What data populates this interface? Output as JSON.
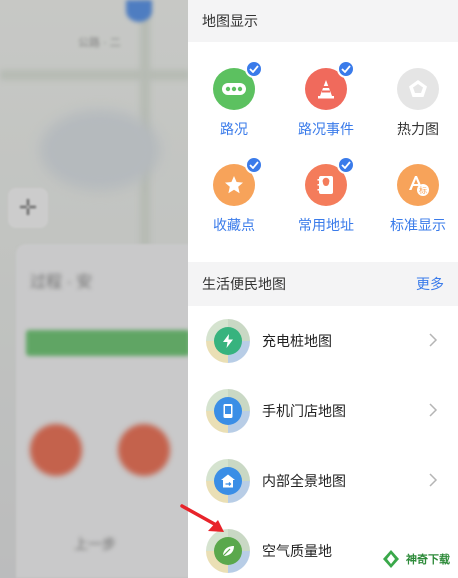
{
  "background": {
    "map_label": "公路 · 二",
    "panel_title": "过程 · 安",
    "bottom_text": "上一步"
  },
  "map_display": {
    "header": "地图显示",
    "tiles": [
      {
        "label": "路况",
        "icon": "traffic-icon",
        "checked": true,
        "color": "#5cc160",
        "label_color": "#3a7bea"
      },
      {
        "label": "路况事件",
        "icon": "traffic-cone-icon",
        "checked": true,
        "color": "#f06a5c",
        "label_color": "#3a7bea"
      },
      {
        "label": "热力图",
        "icon": "heatmap-pentagon-icon",
        "checked": false,
        "color": "#e5e5e5",
        "label_color": "#333333"
      },
      {
        "label": "收藏点",
        "icon": "star-icon",
        "checked": true,
        "color": "#f7a35a",
        "label_color": "#3a7bea"
      },
      {
        "label": "常用地址",
        "icon": "address-book-icon",
        "checked": true,
        "color": "#f47c5b",
        "label_color": "#3a7bea"
      },
      {
        "label": "标准显示",
        "icon": "standard-display-icon",
        "checked": false,
        "color": "#f7a35a",
        "label_color": "#3a7bea"
      }
    ]
  },
  "life_maps": {
    "header": "生活便民地图",
    "more_label": "更多",
    "items": [
      {
        "label": "充电桩地图",
        "icon": "charging-pile-icon",
        "color": "#37b37e"
      },
      {
        "label": "手机门店地图",
        "icon": "phone-store-icon",
        "color": "#3a8ee6"
      },
      {
        "label": "内部全景地图",
        "icon": "panorama-icon",
        "color": "#3a8ee6"
      },
      {
        "label": "空气质量地",
        "icon": "leaf-icon",
        "color": "#5aa84c"
      }
    ]
  },
  "watermark": {
    "text": "神奇下载"
  },
  "colors": {
    "accent": "#3a7bea",
    "annotation_arrow": "#e8232a"
  }
}
